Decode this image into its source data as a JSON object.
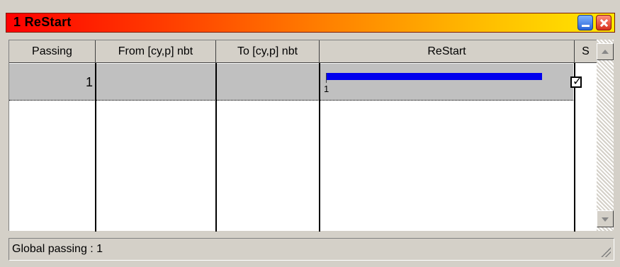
{
  "window": {
    "title": "1  ReStart",
    "controls": {
      "minimize_icon": "minimize-icon",
      "close_icon": "close-icon"
    }
  },
  "table": {
    "columns": [
      "Passing",
      "From [cy,p] nbt",
      "To [cy,p] nbt",
      "ReStart",
      "S"
    ],
    "rows": [
      {
        "passing": "1",
        "from": "",
        "to": "",
        "restart_progress": 1.0,
        "restart_label": "1",
        "s_checked": true
      }
    ]
  },
  "status_bar": {
    "text": "Global passing : 1"
  },
  "colors": {
    "title_gradient_start": "#ff0000",
    "title_gradient_end": "#ffe800",
    "progress": "#0000ee",
    "selected_row": "#c0c0c0"
  }
}
